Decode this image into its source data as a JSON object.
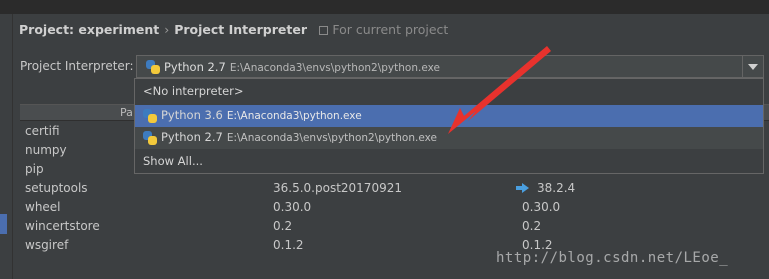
{
  "breadcrumb": {
    "project": "Project: experiment",
    "separator": "›",
    "page": "Project Interpreter",
    "scope": "For current project"
  },
  "interpreter": {
    "label": "Project Interpreter:",
    "selected_name": "Python 2.7",
    "selected_path": "E:\\Anaconda3\\envs\\python2\\python.exe"
  },
  "dropdown": {
    "options": [
      {
        "name": "<No interpreter>",
        "path": ""
      },
      {
        "name": "Python 3.6",
        "path": "E:\\Anaconda3\\python.exe"
      },
      {
        "name": "Python 2.7",
        "path": "E:\\Anaconda3\\envs\\python2\\python.exe"
      },
      {
        "name": "Show All...",
        "path": ""
      }
    ]
  },
  "table": {
    "header_package": "Pa",
    "rows": [
      {
        "package": "certifi",
        "version": "",
        "latest": ""
      },
      {
        "package": "numpy",
        "version": "",
        "latest": ""
      },
      {
        "package": "pip",
        "version": "",
        "latest": ""
      },
      {
        "package": "setuptools",
        "version": "36.5.0.post20170921",
        "latest": "38.2.4"
      },
      {
        "package": "wheel",
        "version": "0.30.0",
        "latest": "0.30.0"
      },
      {
        "package": "wincertstore",
        "version": "0.2",
        "latest": "0.2"
      },
      {
        "package": "wsgiref",
        "version": "0.1.2",
        "latest": "0.1.2"
      }
    ]
  },
  "watermark": "http://blog.csdn.net/LEoe_",
  "colors": {
    "background": "#3c3f41",
    "selection": "#4b6eaf",
    "annotation_arrow": "#e8322d"
  }
}
